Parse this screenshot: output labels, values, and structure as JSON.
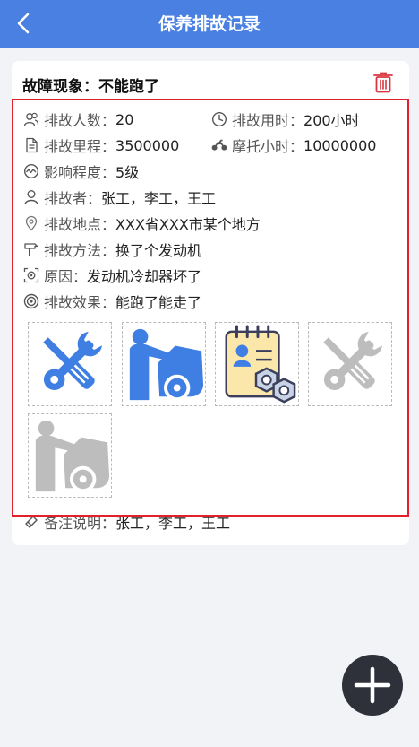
{
  "header": {
    "title": "保养排故记录",
    "back_icon": "chevron-left-icon"
  },
  "record": {
    "fault_label": "故障现象：",
    "fault_value": "不能跑了",
    "fields": {
      "people_label": "排故人数：",
      "people_value": "20",
      "time_label": "排故用时：",
      "time_value": "200小时",
      "mileage_label": "排故里程：",
      "mileage_value": "3500000",
      "moto_label": "摩托小时：",
      "moto_value": "10000000",
      "impact_label": "影响程度：",
      "impact_value": "5级",
      "person_label": "排故者：",
      "person_value": "张工，李工，王工",
      "place_label": "排故地点：",
      "place_value": "XXX省XXX市某个地方",
      "method_label": "排故方法：",
      "method_value": "换了个发动机",
      "cause_label": "原因：",
      "cause_value": "发动机冷却器坏了",
      "effect_label": "排故效果：",
      "effect_value": "能跑了能走了",
      "note_label": "备注说明：",
      "note_value": "张工，李工，王工"
    },
    "photos": [
      "wrench-screwdriver-blue",
      "mechanic-car-blue",
      "notebook-nuts",
      "wrench-screwdriver-gray",
      "mechanic-car-gray"
    ]
  },
  "colors": {
    "header": "#4a80e2",
    "delete": "#d9363e",
    "highlight": "#e0202a",
    "icon_blue": "#3f7ee3",
    "icon_gray": "#bdbdbd",
    "fab": "#2e313a"
  }
}
